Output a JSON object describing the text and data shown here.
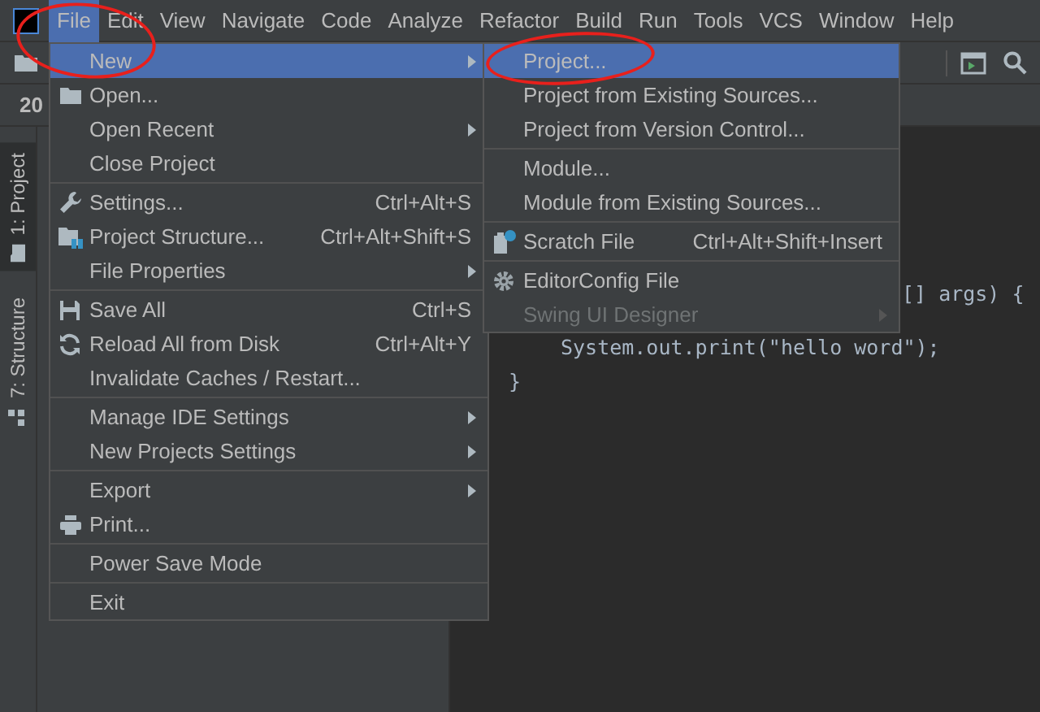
{
  "menubar": [
    {
      "label": "File",
      "selected": true
    },
    {
      "label": "Edit",
      "selected": false
    },
    {
      "label": "View",
      "selected": false
    },
    {
      "label": "Navigate",
      "selected": false
    },
    {
      "label": "Code",
      "selected": false
    },
    {
      "label": "Analyze",
      "selected": false
    },
    {
      "label": "Refactor",
      "selected": false
    },
    {
      "label": "Build",
      "selected": false
    },
    {
      "label": "Run",
      "selected": false
    },
    {
      "label": "Tools",
      "selected": false
    },
    {
      "label": "VCS",
      "selected": false
    },
    {
      "label": "Window",
      "selected": false
    },
    {
      "label": "Help",
      "selected": false
    }
  ],
  "navbar": {
    "path": "20"
  },
  "tool_strip": [
    {
      "label": "1: Project",
      "selected": true
    },
    {
      "label": "7: Structure",
      "selected": false
    }
  ],
  "editor": {
    "lines": [
      "[] args) {",
      "System.out.print(\"hello word\");",
      "}"
    ]
  },
  "file_menu": {
    "groups": [
      {
        "items": [
          {
            "label": "New",
            "submenu": true,
            "selected": true,
            "circled": true
          },
          {
            "label": "Open...",
            "submenu": false,
            "selected": false
          },
          {
            "label": "Open Recent",
            "submenu": true,
            "selected": false
          },
          {
            "label": "Close Project",
            "submenu": false,
            "selected": false
          }
        ]
      },
      {
        "items": [
          {
            "label": "Settings...",
            "shortcut": "Ctrl+Alt+S",
            "submenu": false,
            "selected": false
          },
          {
            "label": "Project Structure...",
            "shortcut": "Ctrl+Alt+Shift+S",
            "submenu": false,
            "selected": false
          },
          {
            "label": "File Properties",
            "submenu": true,
            "selected": false
          }
        ]
      },
      {
        "items": [
          {
            "label": "Save All",
            "shortcut": "Ctrl+S",
            "submenu": false,
            "selected": false
          },
          {
            "label": "Reload All from Disk",
            "shortcut": "Ctrl+Alt+Y",
            "submenu": false,
            "selected": false
          },
          {
            "label": "Invalidate Caches / Restart...",
            "submenu": false,
            "selected": false
          }
        ]
      },
      {
        "items": [
          {
            "label": "Manage IDE Settings",
            "submenu": true,
            "selected": false
          },
          {
            "label": "New Projects Settings",
            "submenu": true,
            "selected": false
          }
        ]
      },
      {
        "items": [
          {
            "label": "Export",
            "submenu": true,
            "selected": false
          },
          {
            "label": "Print...",
            "submenu": false,
            "selected": false
          }
        ]
      },
      {
        "items": [
          {
            "label": "Power Save Mode",
            "submenu": false,
            "selected": false
          }
        ]
      },
      {
        "items": [
          {
            "label": "Exit",
            "submenu": false,
            "selected": false
          }
        ]
      }
    ]
  },
  "new_submenu": {
    "groups": [
      {
        "items": [
          {
            "label": "Project...",
            "submenu": false,
            "selected": true,
            "circled": true
          },
          {
            "label": "Project from Existing Sources...",
            "submenu": false,
            "selected": false
          },
          {
            "label": "Project from Version Control...",
            "submenu": false,
            "selected": false
          }
        ]
      },
      {
        "items": [
          {
            "label": "Module...",
            "submenu": false,
            "selected": false
          },
          {
            "label": "Module from Existing Sources...",
            "submenu": false,
            "selected": false
          }
        ]
      },
      {
        "items": [
          {
            "label": "Scratch File",
            "shortcut": "Ctrl+Alt+Shift+Insert",
            "submenu": false,
            "selected": false
          }
        ]
      },
      {
        "items": [
          {
            "label": "EditorConfig File",
            "submenu": false,
            "selected": false
          },
          {
            "label": "Swing UI Designer",
            "submenu": true,
            "selected": false,
            "disabled": true
          }
        ]
      }
    ]
  }
}
